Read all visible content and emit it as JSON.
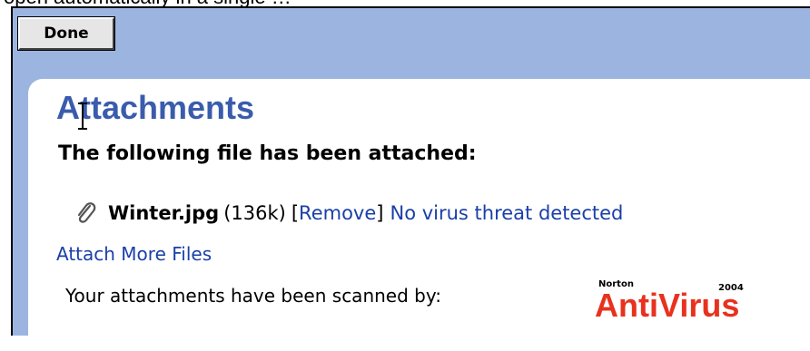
{
  "top_caption": "open automatically in a single …",
  "toolbar": {
    "done_label": "Done"
  },
  "attachments": {
    "title": "Attachments",
    "subtitle": "The following file has been attached:",
    "files": [
      {
        "name": "Winter.jpg",
        "size": "(136k)",
        "remove_label": "Remove",
        "virus_status": "No virus threat detected"
      }
    ],
    "attach_more_label": "Attach More Files",
    "scan_text": "Your attachments have been scanned by:"
  },
  "norton_logo": {
    "brand": "Norton",
    "product": "AntiVirus",
    "year": "2004"
  },
  "colors": {
    "header_bg": "#9cb5e0",
    "title": "#3a5cad",
    "link": "#1a3fa8",
    "logo_red": "#e8321e"
  }
}
